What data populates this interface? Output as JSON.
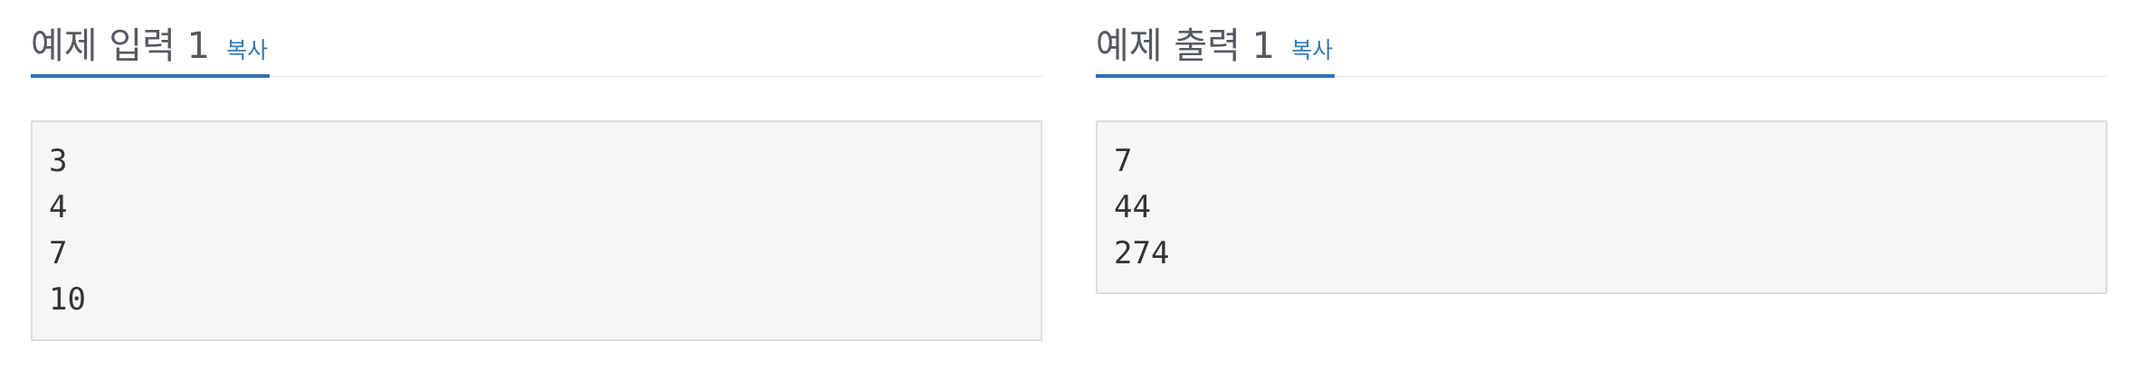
{
  "sample_input": {
    "title": "예제 입력 1",
    "copy_label": "복사",
    "lines": "3\n4\n7\n10"
  },
  "sample_output": {
    "title": "예제 출력 1",
    "copy_label": "복사",
    "lines": "7\n44\n274"
  },
  "colors": {
    "accent": "#2f6fb8",
    "link": "#337ab7",
    "box_bg": "#f5f6f8",
    "box_border": "#dcdcdc",
    "title_text": "#555a60"
  }
}
